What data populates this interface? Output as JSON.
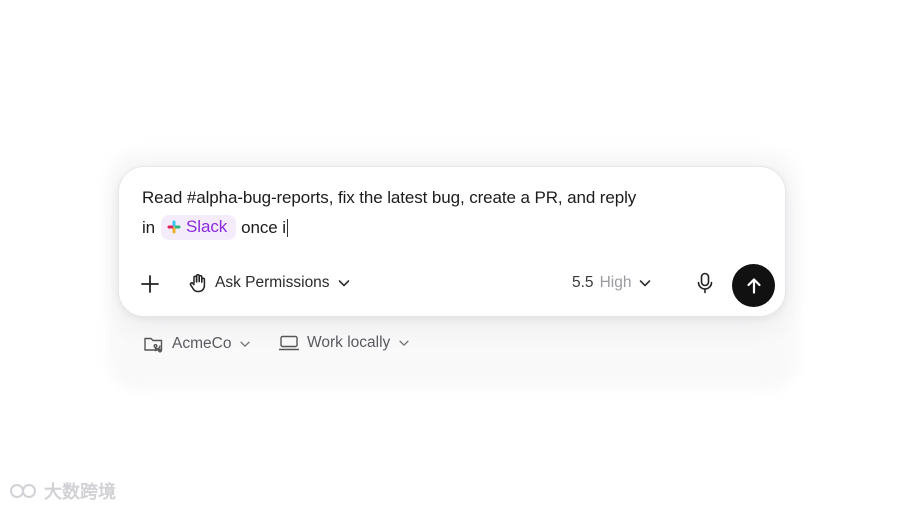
{
  "composer": {
    "prompt_line1": "Read #alpha-bug-reports, fix the latest bug, create a PR, and reply",
    "prompt_line2_start": "in",
    "mention_chip": "Slack",
    "prompt_line2_end": "once i",
    "permission_label": "Ask Permissions",
    "model_version": "5.5",
    "model_level": "High"
  },
  "context": {
    "repo_label": "AcmeCo",
    "environment_label": "Work locally"
  },
  "watermark_text": "大数跨境",
  "icons": {
    "add": "plus-icon",
    "permission": "hand-icon",
    "mic": "microphone-icon",
    "send": "arrow-up-icon",
    "repo": "folder-repo-icon",
    "environment": "laptop-icon",
    "mention": "slack-logo-icon"
  },
  "colors": {
    "chip_bg": "#f4ecfb",
    "chip_text": "#8a2be2",
    "send_button": "#111111"
  }
}
